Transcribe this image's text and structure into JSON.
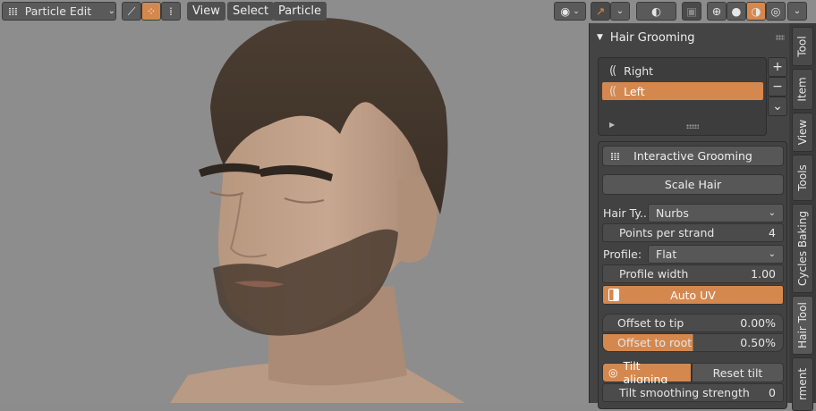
{
  "header": {
    "mode_label": "Particle Edit",
    "menus": [
      "View",
      "Select",
      "Particle"
    ]
  },
  "panel": {
    "title": "Hair Grooming",
    "systems": [
      {
        "name": "Right",
        "selected": false
      },
      {
        "name": "Left",
        "selected": true
      }
    ],
    "list_controls": [
      "+",
      "−",
      "⌄"
    ],
    "interactive_grooming_label": "Interactive Grooming",
    "scale_hair_label": "Scale Hair",
    "hair_type_label": "Hair Ty...",
    "hair_type_value": "Nurbs",
    "points_per_strand_label": "Points per strand",
    "points_per_strand_value": "4",
    "profile_label": "Profile:",
    "profile_value": "Flat",
    "profile_width_label": "Profile width",
    "profile_width_value": "1.00",
    "auto_uv_label": "Auto UV",
    "offset_tip_label": "Offset to tip",
    "offset_tip_value": "0.00%",
    "offset_root_label": "Offset to root",
    "offset_root_value": "0.50%",
    "tilt_aligning_label": "Tilt aligning",
    "reset_tilt_label": "Reset tilt",
    "tilt_smoothing_label": "Tilt smoothing strength",
    "tilt_smoothing_value": "0"
  },
  "tabs": [
    "Tool",
    "Item",
    "View",
    "Tools",
    "Cycles Baking",
    "Hair Tool",
    "rment"
  ],
  "colors": {
    "accent": "#d5884e",
    "panel": "#444444",
    "viewport": "#8d8d8d"
  }
}
